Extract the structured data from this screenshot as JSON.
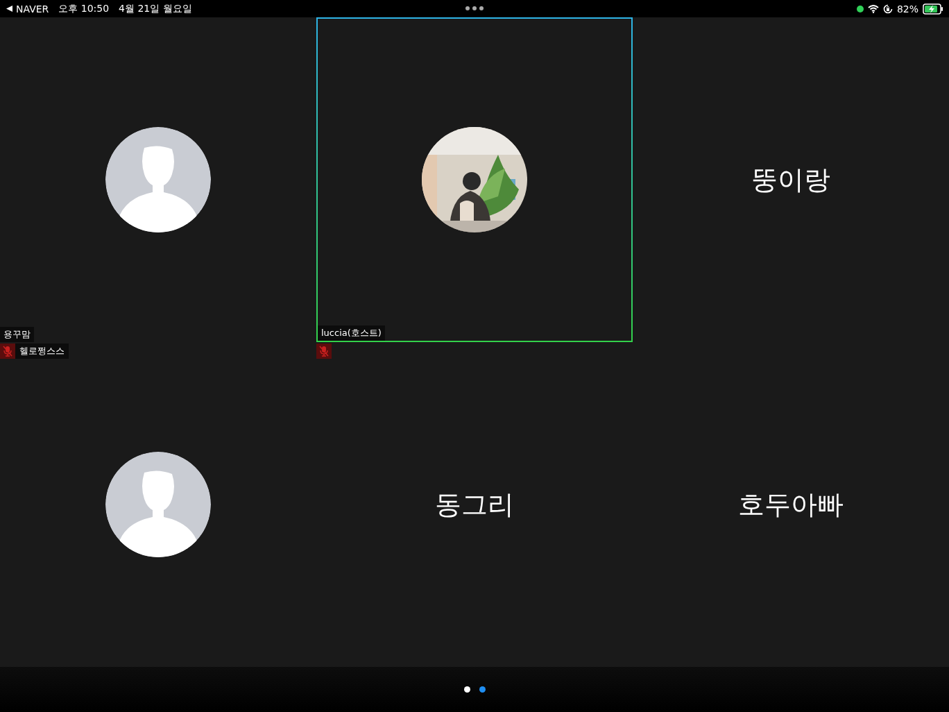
{
  "status_bar": {
    "back_app": "NAVER",
    "time": "오후 10:50",
    "date": "4월 21일 월요일",
    "battery": "82%"
  },
  "tiles": [
    {
      "kind": "avatar",
      "label": "용꾸맘",
      "sub_label": "헬로쩡스스",
      "muted": true
    },
    {
      "label": "luccia(호스트)",
      "muted": true,
      "active": true
    },
    {
      "kind": "name",
      "display_name": "뚱이랑"
    },
    {
      "kind": "avatar"
    },
    {
      "kind": "name",
      "display_name": "동그리"
    },
    {
      "kind": "name",
      "display_name": "호두아빠"
    }
  ],
  "pages": [
    {
      "selected": false
    },
    {
      "selected": true
    }
  ]
}
